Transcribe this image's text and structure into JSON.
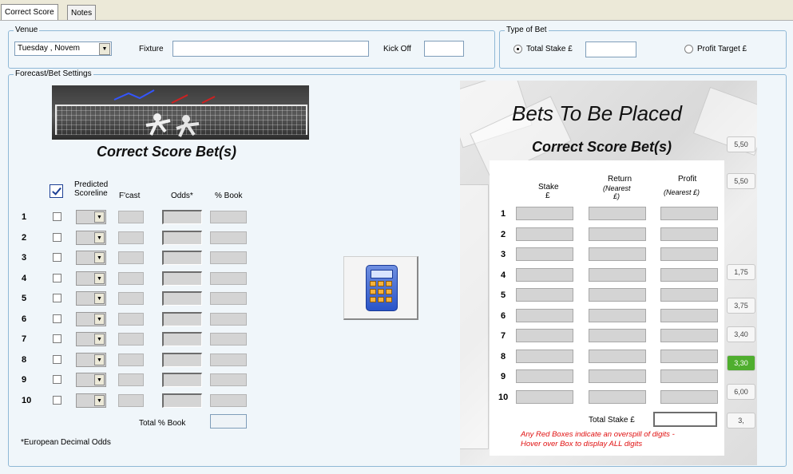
{
  "tabs": [
    {
      "label": "Correct Score"
    },
    {
      "label": "Notes"
    }
  ],
  "venue": {
    "title": "Venue",
    "date_value": "Tuesday  , Novem",
    "fixture_label": "Fixture",
    "fixture_value": "",
    "kickoff_label": "Kick Off",
    "kickoff_value": ""
  },
  "bet_type": {
    "title": "Type of Bet",
    "total_stake_label": "Total Stake £",
    "total_stake_value": "",
    "profit_target_label": "Profit Target £",
    "selected": "total_stake"
  },
  "forecast": {
    "title": "Forecast/Bet Settings",
    "heading": "Correct Score Bet(s)",
    "columns": {
      "predicted": "Predicted Scoreline",
      "fcast": "F'cast",
      "odds": "Odds*",
      "book": "% Book"
    },
    "rows": [
      "1",
      "2",
      "3",
      "4",
      "5",
      "6",
      "7",
      "8",
      "9",
      "10"
    ],
    "total_book_label": "Total % Book",
    "footnote": "*European Decimal Odds"
  },
  "bets": {
    "title": "Bets To Be Placed",
    "subtitle": "Correct Score Bet(s)",
    "columns": {
      "stake_line1": "Stake",
      "stake_line2": "£",
      "return_line1": "Return",
      "return_line2": "(Nearest",
      "return_line3": "£)",
      "profit_line1": "Profit",
      "profit_line2": "(Nearest £)"
    },
    "rows": [
      "1",
      "2",
      "3",
      "4",
      "5",
      "6",
      "7",
      "8",
      "9",
      "10"
    ],
    "total_stake_label": "Total Stake  £",
    "note_line1": "Any Red Boxes indicate an overspill of digits -",
    "note_line2": "Hover over Box to display ALL digits"
  },
  "background_tiles": [
    "5,50",
    "5,50",
    "1,75",
    "3,75",
    "3,40",
    "3,30",
    "6,00",
    "3,"
  ],
  "colors": {
    "panel_bg": "#f0f6fa",
    "group_border": "#8fb8d6",
    "note_red": "#e01010",
    "accent_blue": "#1c3f94"
  }
}
